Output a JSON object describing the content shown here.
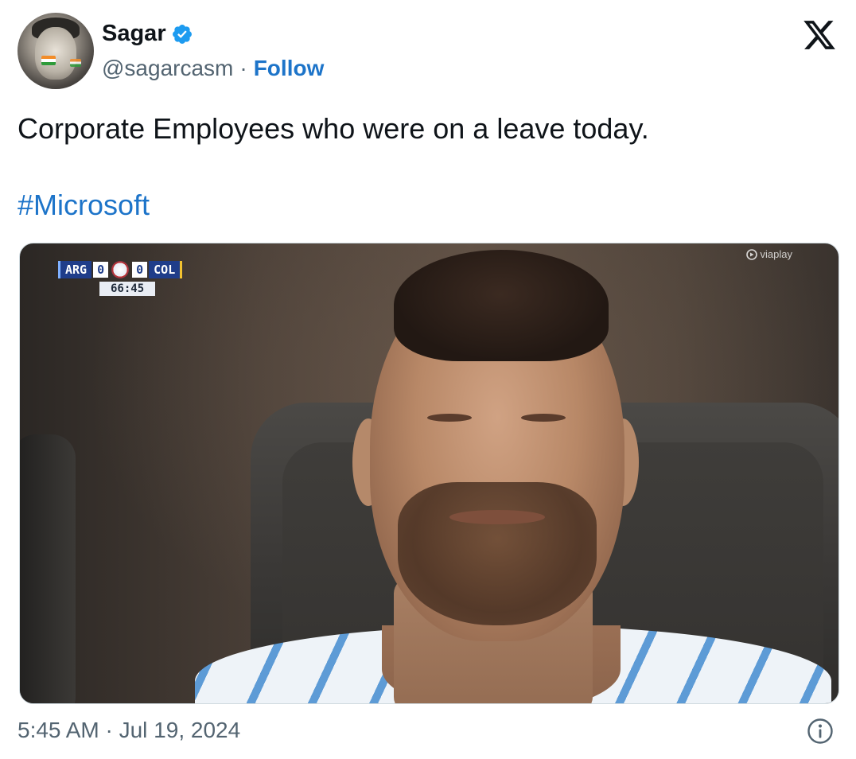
{
  "author": {
    "name": "Sagar",
    "handle": "@sagarcasm",
    "separator": "·",
    "follow_label": "Follow",
    "avatar_icon": "profile-photo",
    "verified_icon": "verified-badge-icon",
    "verified_color": "#1d9bf0"
  },
  "platform": {
    "logo_icon": "x-logo-icon"
  },
  "tweet": {
    "text": "Corporate Employees who were on a leave today.",
    "hashtag": "#Microsoft",
    "hashtag_color": "#1d74c9"
  },
  "media": {
    "scorebug": {
      "home_team": "ARG",
      "home_score": "0",
      "away_score": "0",
      "away_team": "COL",
      "clock": "66:45"
    },
    "watermark": "viaplay"
  },
  "footer": {
    "timestamp": "5:45 AM · Jul 19, 2024",
    "info_icon": "info-icon"
  }
}
